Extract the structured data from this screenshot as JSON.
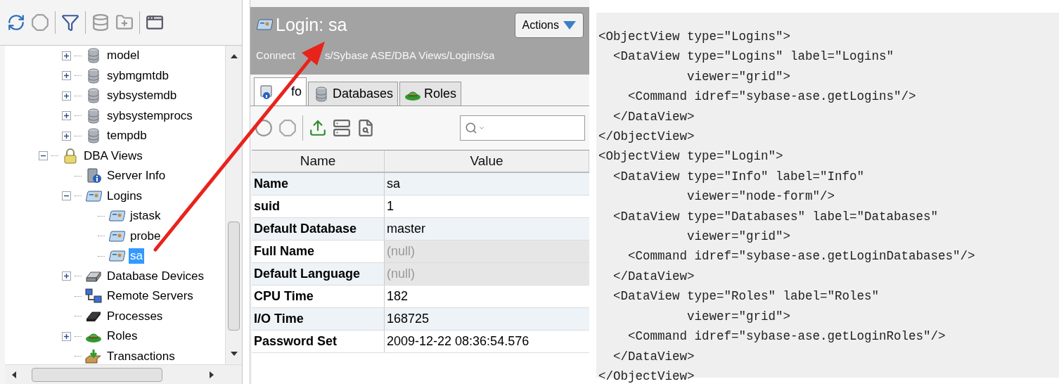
{
  "tree": {
    "items": [
      {
        "label": "model",
        "kind": "database",
        "expanded": false,
        "selected": false
      },
      {
        "label": "sybmgmtdb",
        "kind": "database",
        "expanded": false,
        "selected": false
      },
      {
        "label": "sybsystemdb",
        "kind": "database",
        "expanded": false,
        "selected": false
      },
      {
        "label": "sybsystemprocs",
        "kind": "database",
        "expanded": false,
        "selected": false
      },
      {
        "label": "tempdb",
        "kind": "database",
        "expanded": false,
        "selected": false
      },
      {
        "label": "DBA Views",
        "kind": "lock",
        "expanded": true,
        "selected": false,
        "children": [
          {
            "label": "Server Info",
            "kind": "server-info",
            "selected": false
          },
          {
            "label": "Logins",
            "kind": "login",
            "expanded": true,
            "selected": false,
            "children": [
              {
                "label": "jstask",
                "kind": "login",
                "selected": false
              },
              {
                "label": "probe",
                "kind": "login",
                "selected": false
              },
              {
                "label": "sa",
                "kind": "login",
                "selected": true
              }
            ]
          },
          {
            "label": "Database Devices",
            "kind": "device",
            "expanded": false,
            "selected": false
          },
          {
            "label": "Remote Servers",
            "kind": "remote",
            "selected": false
          },
          {
            "label": "Processes",
            "kind": "chip",
            "selected": false
          },
          {
            "label": "Roles",
            "kind": "hat",
            "expanded": false,
            "selected": false
          },
          {
            "label": "Transactions",
            "kind": "tray",
            "selected": false
          }
        ]
      }
    ]
  },
  "detail": {
    "title": "Login: sa",
    "actions_button": "Actions",
    "breadcrumb": [
      "Connect",
      "s/Sybase ASE/DBA Views/Logins/sa"
    ],
    "tabs": [
      {
        "label": "fo",
        "kind": "info",
        "selected": true
      },
      {
        "label": "Databases",
        "kind": "database",
        "selected": false
      },
      {
        "label": "Roles",
        "kind": "hat",
        "selected": false
      }
    ],
    "table": {
      "columns": [
        "Name",
        "Value"
      ],
      "rows": [
        {
          "name": "Name",
          "value": "sa",
          "null": false
        },
        {
          "name": "suid",
          "value": "1",
          "null": false
        },
        {
          "name": "Default Database",
          "value": "master",
          "null": false
        },
        {
          "name": "Full Name",
          "value": "(null)",
          "null": true
        },
        {
          "name": "Default Language",
          "value": "(null)",
          "null": true
        },
        {
          "name": "CPU Time",
          "value": "182",
          "null": false
        },
        {
          "name": "I/O Time",
          "value": "168725",
          "null": false
        },
        {
          "name": "Password Set",
          "value": "2009-12-22 08:36:54.576",
          "null": false
        }
      ]
    }
  },
  "code": {
    "lines": [
      "<ObjectView type=\"Logins\">",
      "  <DataView type=\"Logins\" label=\"Logins\"",
      "            viewer=\"grid\">",
      "    <Command idref=\"sybase-ase.getLogins\"/>",
      "  </DataView>",
      "</ObjectView>",
      "<ObjectView type=\"Login\">",
      "  <DataView type=\"Info\" label=\"Info\"",
      "            viewer=\"node-form\"/>",
      "  <DataView type=\"Databases\" label=\"Databases\"",
      "            viewer=\"grid\">",
      "    <Command idref=\"sybase-ase.getLoginDatabases\"/>",
      "  </DataView>",
      "  <DataView type=\"Roles\" label=\"Roles\"",
      "            viewer=\"grid\">",
      "    <Command idref=\"sybase-ase.getLoginRoles\"/>",
      "  </DataView>",
      "</ObjectView>"
    ]
  }
}
